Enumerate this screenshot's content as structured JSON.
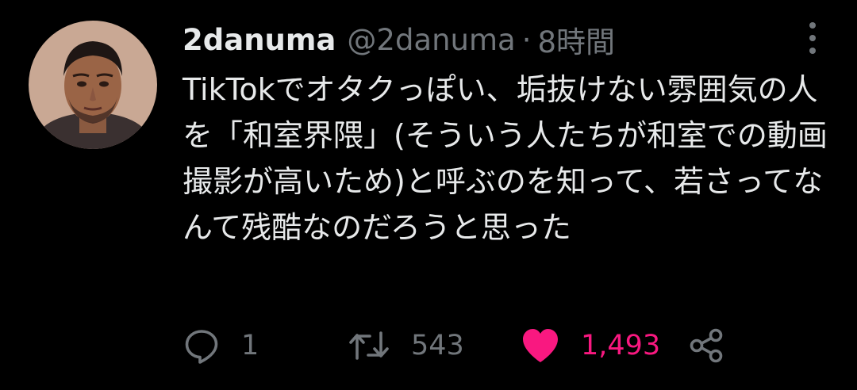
{
  "tweet": {
    "display_name": "2danuma",
    "handle": "@2danuma",
    "separator": "·",
    "timestamp": "8時間",
    "text": "TikTokでオタクっぽい、垢抜けない雰囲気の人を「和室界隈」(そういう人たちが和室での動画撮影が高いため)と呼ぶのを知って、若さってなんて残酷なのだろうと思った"
  },
  "actions": {
    "reply": {
      "icon": "reply-icon",
      "count": "1"
    },
    "retweet": {
      "icon": "retweet-icon",
      "count": "543"
    },
    "like": {
      "icon": "heart-icon",
      "count": "1,493",
      "liked": true
    },
    "share": {
      "icon": "share-icon"
    }
  },
  "colors": {
    "background": "#000000",
    "primary_text": "#e7e9ea",
    "secondary_text": "#71767b",
    "like": "#f91880"
  }
}
